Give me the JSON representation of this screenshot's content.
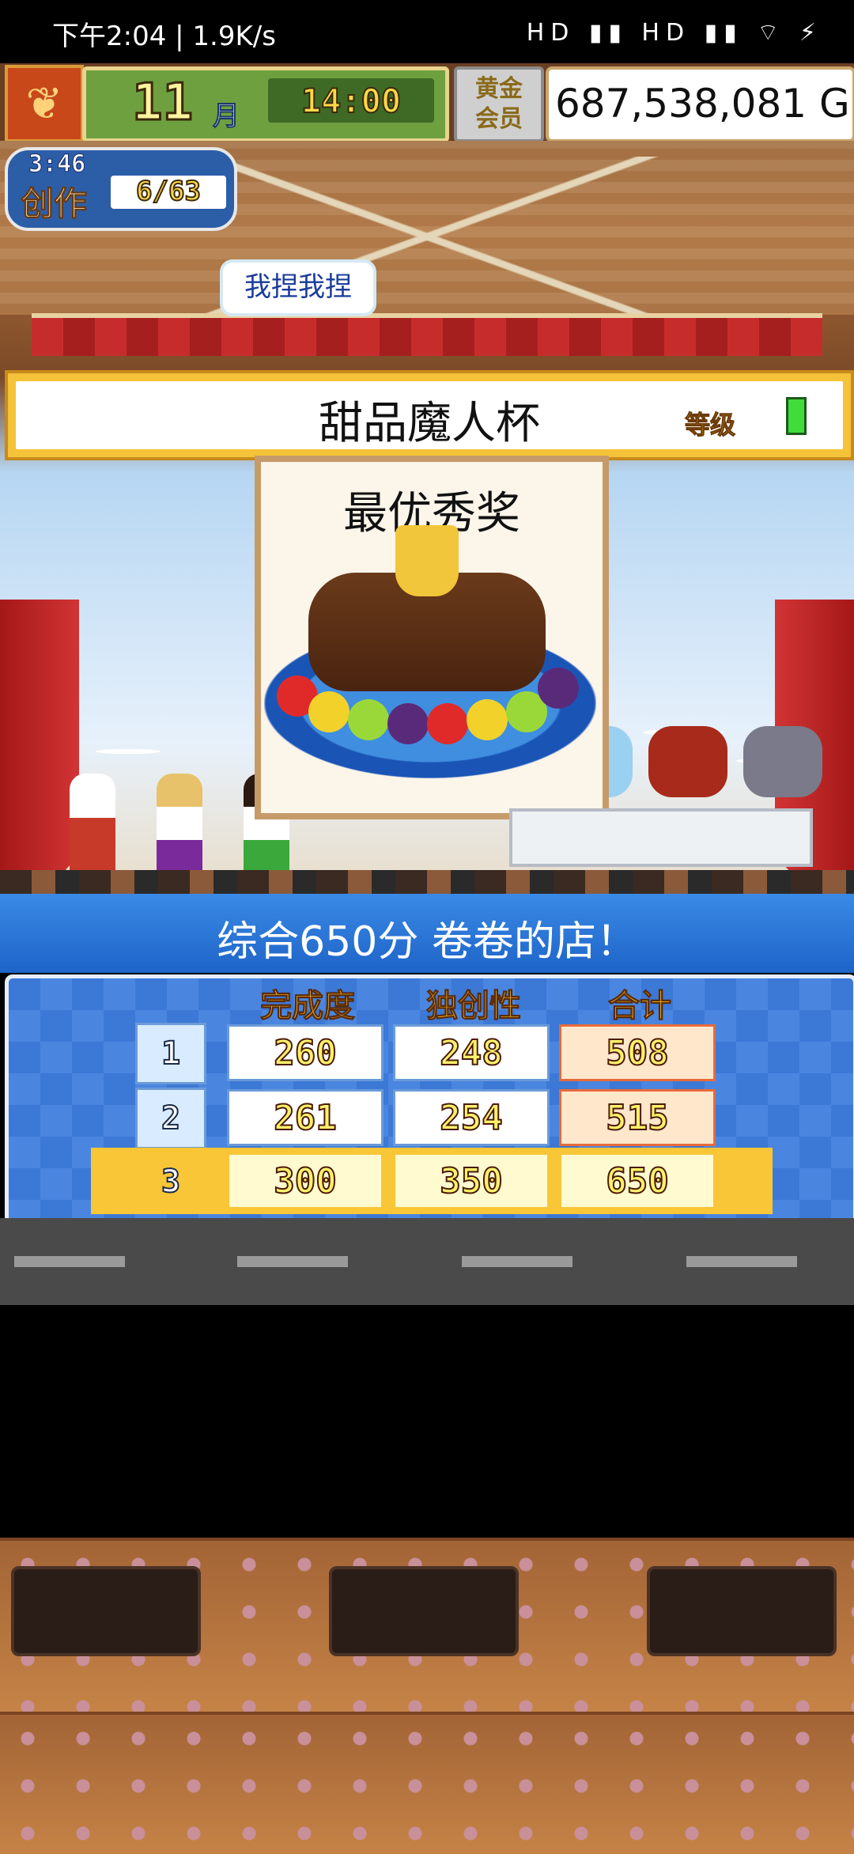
{
  "status_bar": {
    "time": "下午2:04 | 1.9K/s",
    "icons": "HD ▮▮ HD ▮▮ ⌔ ⚡"
  },
  "hud": {
    "season_icon": "maple-leaf-icon",
    "month": "11",
    "month_label": "月",
    "clock": "14:00",
    "gold_member": [
      "黄金",
      "会员"
    ],
    "money": "687,538,081 G"
  },
  "creation": {
    "timer": "3:46",
    "label": "创作",
    "count": "6/63"
  },
  "bubble": "我捏我捏",
  "contest": {
    "title": "甜品魔人杯",
    "rank_tag": "等级",
    "award": "最优秀奖"
  },
  "result": {
    "summary": "综合650分 卷卷的店！",
    "headers": [
      "完成度",
      "独创性",
      "合计"
    ],
    "rows": [
      {
        "rank": "1",
        "completion": "260",
        "originality": "248",
        "total": "508"
      },
      {
        "rank": "2",
        "completion": "261",
        "originality": "254",
        "total": "515"
      },
      {
        "rank": "3",
        "completion": "300",
        "originality": "350",
        "total": "650"
      }
    ]
  },
  "colors": {
    "accent_blue": "#1e64c8",
    "gold": "#f8c636",
    "brown": "#6a3e22"
  }
}
